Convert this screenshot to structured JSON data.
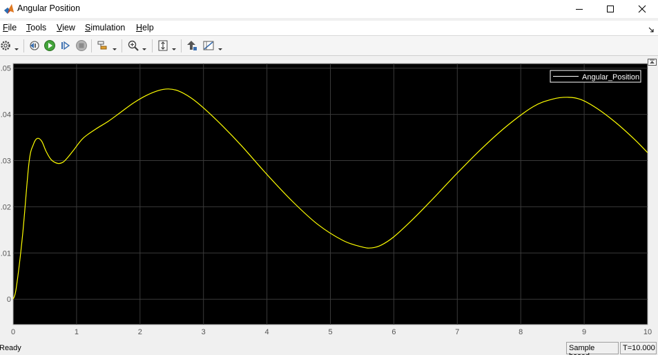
{
  "window": {
    "title": "Angular Position",
    "controls": [
      "minimize",
      "maximize",
      "close"
    ]
  },
  "menu": {
    "items": [
      {
        "label": "File",
        "mnemonic": "F",
        "rest": "ile"
      },
      {
        "label": "Tools",
        "mnemonic": "T",
        "rest": "ools"
      },
      {
        "label": "View",
        "mnemonic": "V",
        "rest": "iew"
      },
      {
        "label": "Simulation",
        "mnemonic": "S",
        "rest": "imulation"
      },
      {
        "label": "Help",
        "mnemonic": "H",
        "rest": "elp"
      }
    ]
  },
  "toolbar": {
    "buttons": [
      "settings-icon",
      "step-back-icon",
      "run-icon",
      "step-forward-icon",
      "stop-icon",
      "signal-select-icon",
      "zoom-icon",
      "scale-axes-icon",
      "highlight-icon",
      "cursor-measure-icon"
    ]
  },
  "status": {
    "ready": "Ready",
    "mode": "Sample based",
    "time": "T=10.000"
  },
  "colors": {
    "plot_background": "#000000",
    "grid": "#3a3a3a",
    "signal": "#ffff00",
    "legend_text": "#ffffff"
  },
  "chart_data": {
    "type": "line",
    "title": "",
    "xlabel": "",
    "ylabel": "",
    "xlim": [
      0,
      10
    ],
    "ylim": [
      -0.0055,
      0.051
    ],
    "grid": true,
    "legend_placement": "top-right",
    "xticks": [
      "0",
      "1",
      "2",
      "3",
      "4",
      "5",
      "6",
      "7",
      "8",
      "9",
      "10"
    ],
    "yticks": [
      {
        "value": 0,
        "label": "0"
      },
      {
        "value": 0.01,
        "label": ".01"
      },
      {
        "value": 0.02,
        "label": ".02"
      },
      {
        "value": 0.03,
        "label": ".03"
      },
      {
        "value": 0.04,
        "label": ".04"
      },
      {
        "value": 0.05,
        "label": ".05"
      }
    ],
    "series": [
      {
        "name": "Angular_Position",
        "color": "#ffff00",
        "x": [
          0,
          0.05,
          0.15,
          0.25,
          0.32,
          0.38,
          0.45,
          0.52,
          0.6,
          0.7,
          0.78,
          0.85,
          0.95,
          1.1,
          1.3,
          1.5,
          1.7,
          1.9,
          2.1,
          2.3,
          2.45,
          2.6,
          2.8,
          3.0,
          3.3,
          3.6,
          4.0,
          4.4,
          4.8,
          5.2,
          5.5,
          5.65,
          5.8,
          6.0,
          6.3,
          6.6,
          7.0,
          7.4,
          7.8,
          8.2,
          8.5,
          8.75,
          8.95,
          9.2,
          9.5,
          9.8,
          10.0
        ],
        "y": [
          0.0,
          0.0025,
          0.014,
          0.0295,
          0.0335,
          0.0348,
          0.0342,
          0.032,
          0.0302,
          0.0294,
          0.0296,
          0.0305,
          0.0322,
          0.0348,
          0.0368,
          0.0385,
          0.0405,
          0.0425,
          0.0441,
          0.0452,
          0.0455,
          0.0451,
          0.0436,
          0.0414,
          0.0375,
          0.0332,
          0.027,
          0.0212,
          0.0162,
          0.0127,
          0.0113,
          0.0111,
          0.0117,
          0.0135,
          0.0173,
          0.0215,
          0.0273,
          0.0328,
          0.0377,
          0.0417,
          0.0433,
          0.0437,
          0.0432,
          0.0413,
          0.0382,
          0.0345,
          0.0317
        ]
      }
    ]
  }
}
